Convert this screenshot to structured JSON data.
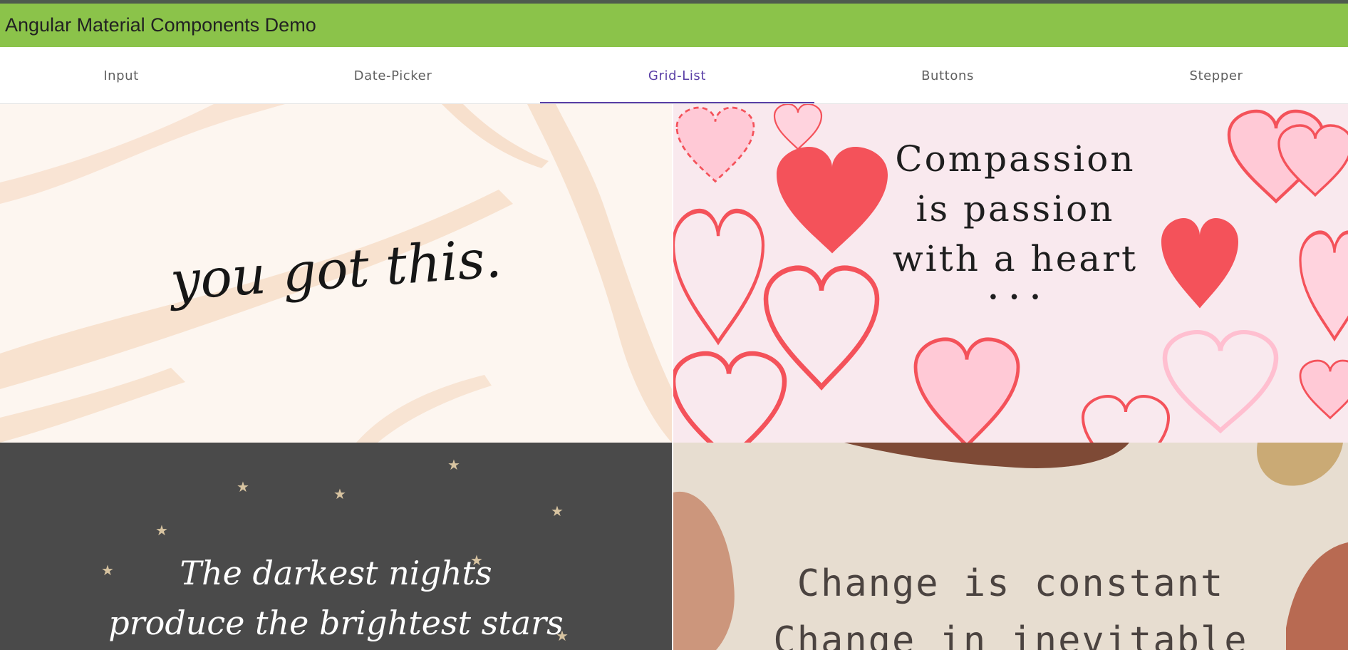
{
  "app": {
    "title": "Angular Material Components Demo"
  },
  "tabs": [
    {
      "label": "Input",
      "active": false
    },
    {
      "label": "Date-Picker",
      "active": false
    },
    {
      "label": "Grid-List",
      "active": true
    },
    {
      "label": "Buttons",
      "active": false
    },
    {
      "label": "Stepper",
      "active": false
    }
  ],
  "colors": {
    "toolbar": "#8bc34a",
    "accent": "#5a3fa6",
    "heart_red": "#f4525a",
    "heart_pink": "#ffc9d6"
  },
  "grid": {
    "tiles": [
      {
        "lines": [
          "you got this."
        ]
      },
      {
        "lines": [
          "Compassion",
          "is passion",
          "with a heart",
          "• • •"
        ]
      },
      {
        "lines": [
          "The darkest nights",
          "produce the brightest stars"
        ]
      },
      {
        "lines": [
          "Change is constant",
          "Change in inevitable"
        ]
      }
    ]
  }
}
